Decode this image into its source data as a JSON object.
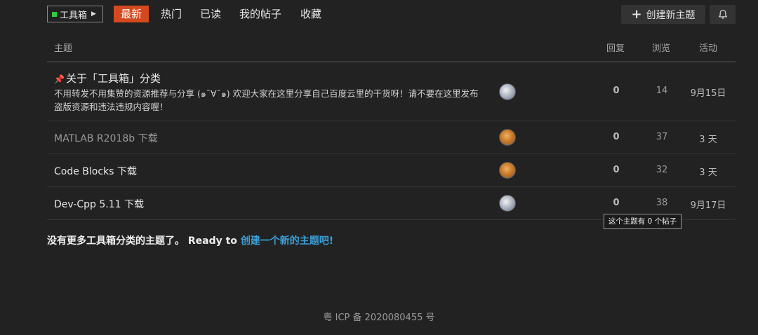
{
  "nav": {
    "category": "工具箱",
    "tabs": [
      "最新",
      "热门",
      "已读",
      "我的帖子",
      "收藏"
    ],
    "new_topic": "创建新主题",
    "icons": {
      "plus": "plus-icon",
      "bell": "bell-icon",
      "caret": "caret-right-icon",
      "pin": "pin-icon"
    },
    "colors": {
      "active_tab": "#d4491f",
      "category_swatch": "#2ecc40",
      "link": "#3ba0d8"
    }
  },
  "table": {
    "headers": {
      "topic": "主题",
      "replies": "回复",
      "views": "浏览",
      "activity": "活动"
    },
    "rows": [
      {
        "title": "关于「工具箱」分类",
        "pinned": true,
        "excerpt": "不用转发不用集赞的资源推荐与分享 (๑¯∀¯๑) 欢迎大家在这里分享自己百度云里的干货呀！请不要在这里发布盗版资源和违法违规内容喔！",
        "replies": "0",
        "views": "14",
        "activity": "9月15日"
      },
      {
        "title": "MATLAB R2018b 下载",
        "replies": "0",
        "views": "37",
        "activity": "3 天"
      },
      {
        "title": "Code Blocks 下载",
        "replies": "0",
        "views": "32",
        "activity": "3 天"
      },
      {
        "title": "Dev-Cpp 5.11 下载",
        "replies": "0",
        "views": "38",
        "activity": "9月17日"
      }
    ]
  },
  "tooltip": "这个主题有 0 个帖子",
  "footer": {
    "message": "没有更多工具箱分类的主题了。 Ready to ",
    "link": "创建一个新的主题吧!",
    "icp": "粤 ICP 备 2020080455 号"
  }
}
